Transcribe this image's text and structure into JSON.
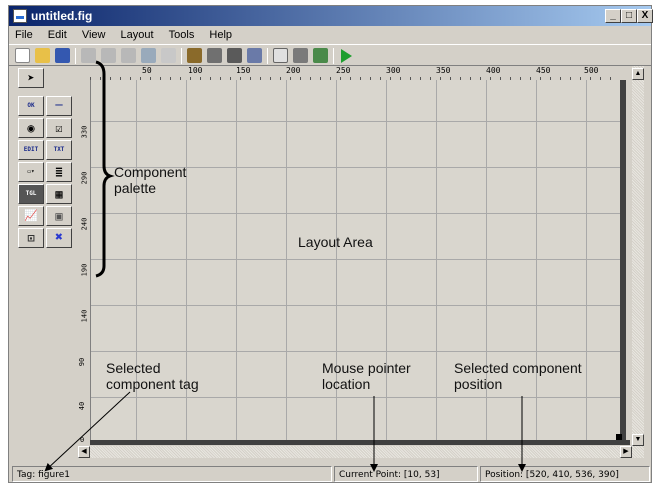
{
  "window": {
    "title": "untitled.fig",
    "controls": {
      "minimize": "_",
      "maximize": "□",
      "close": "X"
    }
  },
  "menu": [
    "File",
    "Edit",
    "View",
    "Layout",
    "Tools",
    "Help"
  ],
  "toolbar_icons": [
    "new-icon",
    "open-icon",
    "save-icon",
    "cut-icon",
    "copy-icon",
    "paste-icon",
    "undo-icon",
    "redo-icon",
    "align-icon",
    "menu-editor-icon",
    "tab-order-icon",
    "toolbar-editor-icon",
    "mfile-editor-icon",
    "property-inspector-icon",
    "object-browser-icon",
    "run-icon"
  ],
  "palette": {
    "items": [
      {
        "name": "select-tool",
        "glyph": "➤"
      },
      {
        "name": "push-button",
        "glyph": "OK"
      },
      {
        "name": "slider",
        "glyph": "━━"
      },
      {
        "name": "radio-button",
        "glyph": "◉"
      },
      {
        "name": "checkbox",
        "glyph": "☑"
      },
      {
        "name": "edit-text",
        "glyph": "EDIT"
      },
      {
        "name": "static-text",
        "glyph": "TXT"
      },
      {
        "name": "popup-menu",
        "glyph": "▭▾"
      },
      {
        "name": "listbox",
        "glyph": "≣"
      },
      {
        "name": "toggle-button",
        "glyph": "TGL"
      },
      {
        "name": "table",
        "glyph": "▦"
      },
      {
        "name": "axes",
        "glyph": "📈"
      },
      {
        "name": "panel",
        "glyph": "▣"
      },
      {
        "name": "button-group",
        "glyph": "⊡"
      },
      {
        "name": "activex",
        "glyph": "✖"
      }
    ]
  },
  "ruler_top": [
    "50",
    "100",
    "150",
    "200",
    "250",
    "300",
    "350",
    "400",
    "450",
    "500"
  ],
  "ruler_left": [
    "330",
    "290",
    "240",
    "190",
    "140",
    "90",
    "40",
    "0"
  ],
  "annotations": {
    "palette_label_line1": "Component",
    "palette_label_line2": "palette",
    "layout_label": "Layout Area",
    "tag_label_line1": "Selected",
    "tag_label_line2": "component tag",
    "pointer_label_line1": "Mouse pointer",
    "pointer_label_line2": "location",
    "position_label_line1": "Selected component",
    "position_label_line2": "position"
  },
  "status": {
    "tag": "Tag: figure1",
    "current_point": "Current Point:  [10, 53]",
    "position": "Position: [520, 410, 536, 390]"
  },
  "colors": {
    "titlebar_start": "#0a246a",
    "titlebar_end": "#a6caf0",
    "run_green": "#1e9e2e"
  }
}
